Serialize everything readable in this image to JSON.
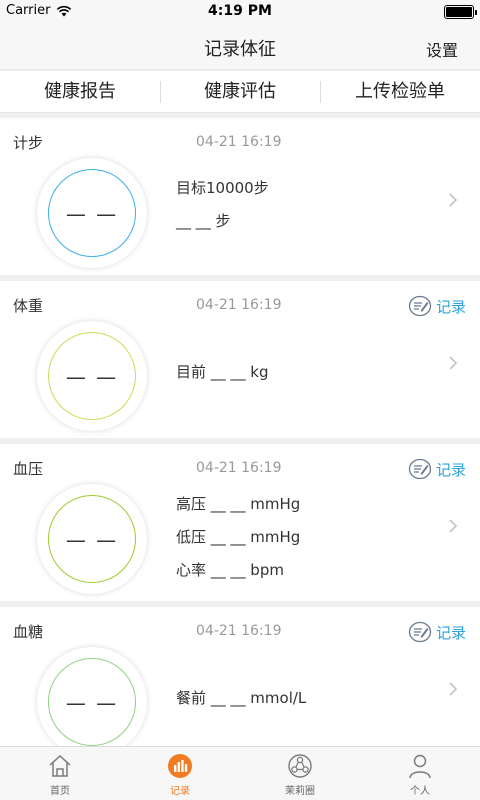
{
  "status_bar": {
    "carrier": "Carrier",
    "time": "4:19 PM"
  },
  "nav": {
    "title": "记录体征",
    "settings_label": "设置"
  },
  "top_tabs": [
    "健康报告",
    "健康评估",
    "上传检验单"
  ],
  "colors": {
    "accent_blue": "#2ba3dc",
    "active_orange": "#f07b22"
  },
  "cards": [
    {
      "name": "计步",
      "datetime": "04-21 16:19",
      "gauge_value": "— —",
      "ring_color": "#3aaee6",
      "record_label": "",
      "metrics": [
        "目标10000步",
        "__ __ 步"
      ]
    },
    {
      "name": "体重",
      "datetime": "04-21 16:19",
      "gauge_value": "— —",
      "ring_color": "#c9de55",
      "record_label": "记录",
      "metrics": [
        "目前 __ __ kg"
      ]
    },
    {
      "name": "血压",
      "datetime": "04-21 16:19",
      "gauge_value": "— —",
      "ring_color": "#9ccc2e",
      "record_label": "记录",
      "metrics": [
        "高压 __ __ mmHg",
        "低压 __ __ mmHg",
        "心率 __ __ bpm"
      ]
    },
    {
      "name": "血糖",
      "datetime": "04-21 16:19",
      "gauge_value": "— —",
      "ring_color": "#8fd17f",
      "record_label": "记录",
      "metrics": [
        "餐前 __ __ mmol/L"
      ]
    }
  ],
  "tab_bar": [
    {
      "label": "首页",
      "icon": "home-icon",
      "active": false
    },
    {
      "label": "记录",
      "icon": "record-icon",
      "active": true
    },
    {
      "label": "茉莉圈",
      "icon": "circle-icon",
      "active": false
    },
    {
      "label": "个人",
      "icon": "person-icon",
      "active": false
    }
  ]
}
